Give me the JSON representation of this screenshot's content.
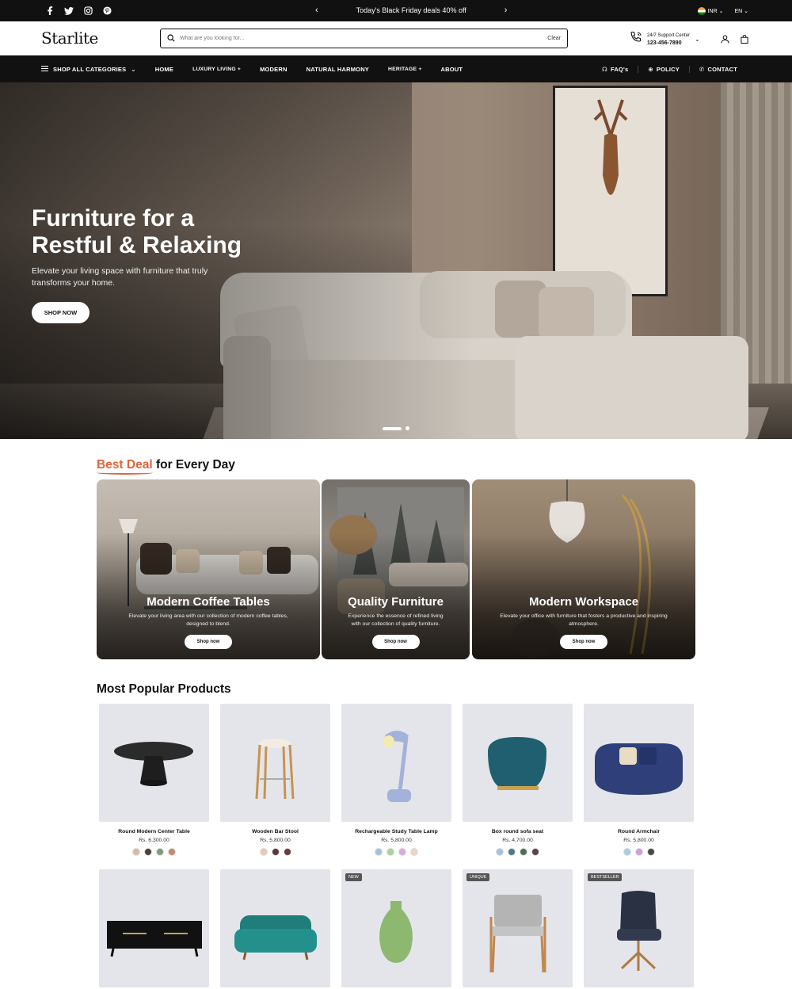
{
  "announcement": {
    "promo_text": "Today's Black Friday deals 40% off",
    "currency": "INR",
    "language": "EN"
  },
  "header": {
    "logo": "Starlite",
    "search_placeholder": "What are you looking for...",
    "clear_label": "Clear",
    "support_label": "24/7 Support Center",
    "support_phone": "123-456-7890"
  },
  "nav": {
    "shop_all": "SHOP ALL CATEGORIES",
    "items": [
      "HOME",
      "LUXURY LIVING +",
      "MODERN",
      "NATURAL HARMONY",
      "HERITAGE +",
      "ABOUT"
    ],
    "right": [
      "FAQ's",
      "POLICY",
      "CONTACT"
    ]
  },
  "hero": {
    "title": "Furniture for a Restful & Relaxing",
    "subtitle": "Elevate your living space with furniture that truly transforms your home.",
    "button": "SHOP NOW"
  },
  "best_deal": {
    "title_accent": "Best Deal",
    "title_rest": " for Every Day",
    "cards": [
      {
        "title": "Modern Coffee Tables",
        "text": "Elevate your living area with our collection of modern coffee tables, designed to blend.",
        "button": "Shop now"
      },
      {
        "title": "Quality Furniture",
        "text": "Experience the essence of refined living with our collection of quality furniture.",
        "button": "Shop now"
      },
      {
        "title": "Modern Workspace",
        "text": "Elevate your office with furniture that fosters a productive and inspiring atmosphere.",
        "button": "Shop now"
      }
    ]
  },
  "popular": {
    "title": "Most Popular Products",
    "products": [
      {
        "name": "Round Modern Center Table",
        "price": "Rs. 6,300.00",
        "swatches": [
          "#d9b9a0",
          "#4a3f3a",
          "#7d9c7a",
          "#c48b6e"
        ]
      },
      {
        "name": "Wooden Bar Stool",
        "price": "Rs. 5,800.00",
        "swatches": [
          "#e5cbb6",
          "#5a3b39",
          "#6b3a3a"
        ]
      },
      {
        "name": "Rechargeable Study Table Lamp",
        "price": "Rs. 5,800.00",
        "swatches": [
          "#9fc3dc",
          "#a8d39a",
          "#d9a8e0",
          "#f0d4c4"
        ]
      },
      {
        "name": "Box round sofa seat",
        "price": "Rs. 4,700.00",
        "swatches": [
          "#a9bfe0",
          "#4d7b8a",
          "#4f6e55",
          "#5b4545"
        ]
      },
      {
        "name": "Round Armchair",
        "price": "Rs. 5,800.00",
        "swatches": [
          "#a8cde0",
          "#d49be0",
          "#4a4a44"
        ]
      }
    ],
    "row2_badges": [
      "NEW",
      "UNIQUE",
      "BESTSELLER"
    ]
  }
}
